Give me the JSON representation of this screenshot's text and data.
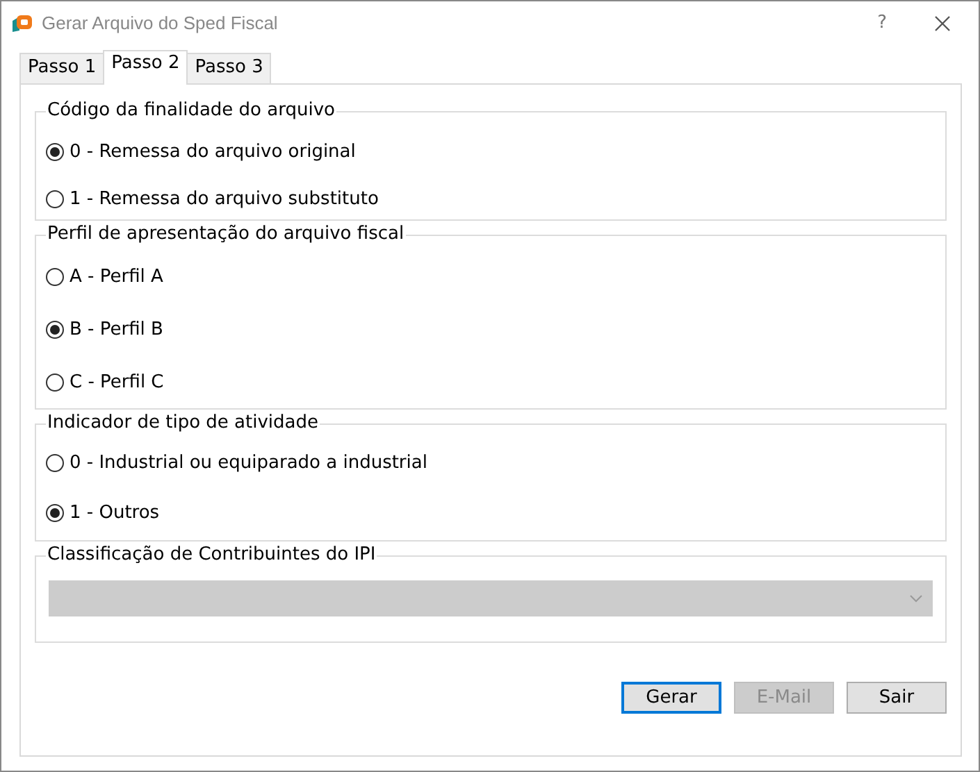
{
  "window": {
    "title": "Gerar Arquivo do Sped Fiscal",
    "help": "?"
  },
  "tabs": [
    {
      "label": "Passo 1",
      "selected": false
    },
    {
      "label": "Passo 2",
      "selected": true
    },
    {
      "label": "Passo 3",
      "selected": false
    }
  ],
  "groups": [
    {
      "kind": "radio",
      "title": "Código da finalidade do arquivo",
      "options": [
        {
          "label": "0 - Remessa do arquivo original",
          "selected": true
        },
        {
          "label": "1 - Remessa do arquivo substituto",
          "selected": false
        }
      ]
    },
    {
      "kind": "radio",
      "title": "Perfil de apresentação do arquivo fiscal",
      "options": [
        {
          "label": "A - Perfil A",
          "selected": false
        },
        {
          "label": "B - Perfil B",
          "selected": true
        },
        {
          "label": "C - Perfil C",
          "selected": false
        }
      ]
    },
    {
      "kind": "radio",
      "title": "Indicador de tipo de atividade",
      "options": [
        {
          "label": "0 - Industrial ou equiparado a industrial",
          "selected": false
        },
        {
          "label": "1 - Outros",
          "selected": true
        }
      ]
    },
    {
      "kind": "select",
      "title": "Classificação de Contribuintes do IPI",
      "disabled": true
    }
  ],
  "buttons": [
    {
      "label": "Gerar",
      "disabled": false,
      "default": true
    },
    {
      "label": "E-Mail",
      "disabled": true,
      "default": false
    },
    {
      "label": "Sair",
      "disabled": false,
      "default": false
    }
  ]
}
